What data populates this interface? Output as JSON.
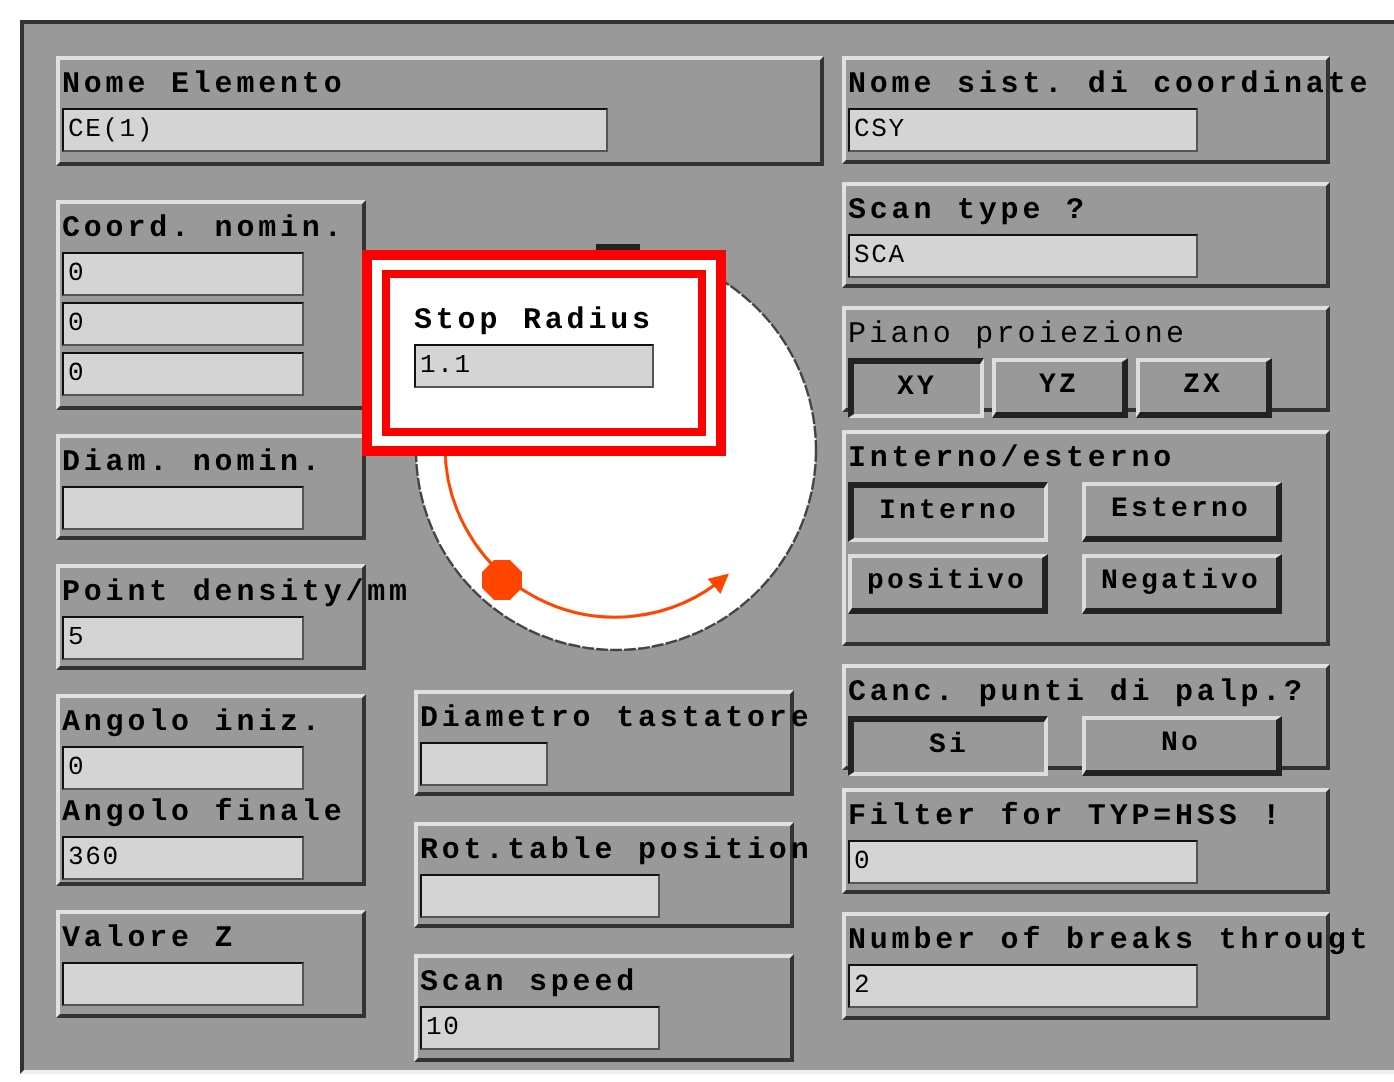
{
  "element_name": {
    "label": "Nome Elemento",
    "value": "CE(1)"
  },
  "left_panels": [
    {
      "items": [
        {
          "kind": "label",
          "text": "Coord. nomin."
        },
        {
          "kind": "input",
          "value": "0"
        },
        {
          "kind": "input",
          "value": "0"
        },
        {
          "kind": "input",
          "value": "0"
        }
      ]
    },
    {
      "items": [
        {
          "kind": "label",
          "text": "Diam. nomin."
        },
        {
          "kind": "input"
        }
      ]
    },
    {
      "items": [
        {
          "kind": "label",
          "text": "Point density/mm"
        },
        {
          "kind": "input",
          "value": "5"
        }
      ]
    },
    {
      "items": [
        {
          "kind": "label",
          "text": "Angolo iniz."
        },
        {
          "kind": "input",
          "value": "0"
        },
        {
          "kind": "label",
          "text": "Angolo finale"
        },
        {
          "kind": "input",
          "value": "360"
        }
      ]
    },
    {
      "items": [
        {
          "kind": "label",
          "text": "Valore Z"
        },
        {
          "kind": "input"
        }
      ]
    }
  ],
  "stop_radius": {
    "label": "Stop Radius",
    "value": "1.1"
  },
  "middle_panels": [
    {
      "items": [
        {
          "kind": "label",
          "text": "Diametro tastatore"
        },
        {
          "kind": "input"
        }
      ]
    },
    {
      "items": [
        {
          "kind": "label",
          "text": "Rot.table position"
        },
        {
          "kind": "input"
        }
      ]
    },
    {
      "items": [
        {
          "kind": "label",
          "text": "Scan speed"
        },
        {
          "kind": "input",
          "value": "10"
        }
      ]
    }
  ],
  "right_panels": [
    {
      "items": [
        {
          "kind": "label",
          "text": "Nome sist. di coordinate"
        },
        {
          "kind": "input",
          "value": "CSY"
        }
      ]
    },
    {
      "items": [
        {
          "kind": "label",
          "text": "Scan type ?"
        },
        {
          "kind": "input",
          "value": "SCA"
        }
      ]
    },
    {
      "items": [
        {
          "kind": "caption",
          "text": "Piano proiezione"
        },
        {
          "kind": "choices",
          "options": [
            {
              "label": "XY",
              "selected": true
            },
            {
              "label": "YZ",
              "selected": false
            },
            {
              "label": "ZX",
              "selected": false
            }
          ]
        }
      ]
    },
    {
      "items": [
        {
          "kind": "label",
          "text": "Interno/esterno"
        },
        {
          "kind": "choices",
          "options": [
            {
              "label": "Interno",
              "selected": true
            },
            {
              "label": "Esterno",
              "selected": false
            }
          ]
        },
        {
          "kind": "choices",
          "options": [
            {
              "label": "positivo",
              "selected": false
            },
            {
              "label": "Negativo",
              "selected": false
            }
          ]
        }
      ]
    },
    {
      "items": [
        {
          "kind": "label",
          "text": "Canc. punti di palp.?"
        },
        {
          "kind": "choices",
          "options": [
            {
              "label": "Si",
              "selected": true
            },
            {
              "label": "No",
              "selected": false
            }
          ]
        }
      ]
    },
    {
      "items": [
        {
          "kind": "label",
          "text": "Filter for TYP=HSS !"
        },
        {
          "kind": "input",
          "value": "0"
        }
      ]
    },
    {
      "items": [
        {
          "kind": "label",
          "text": "Number of breaks througt"
        },
        {
          "kind": "input",
          "value": "2"
        }
      ]
    }
  ]
}
